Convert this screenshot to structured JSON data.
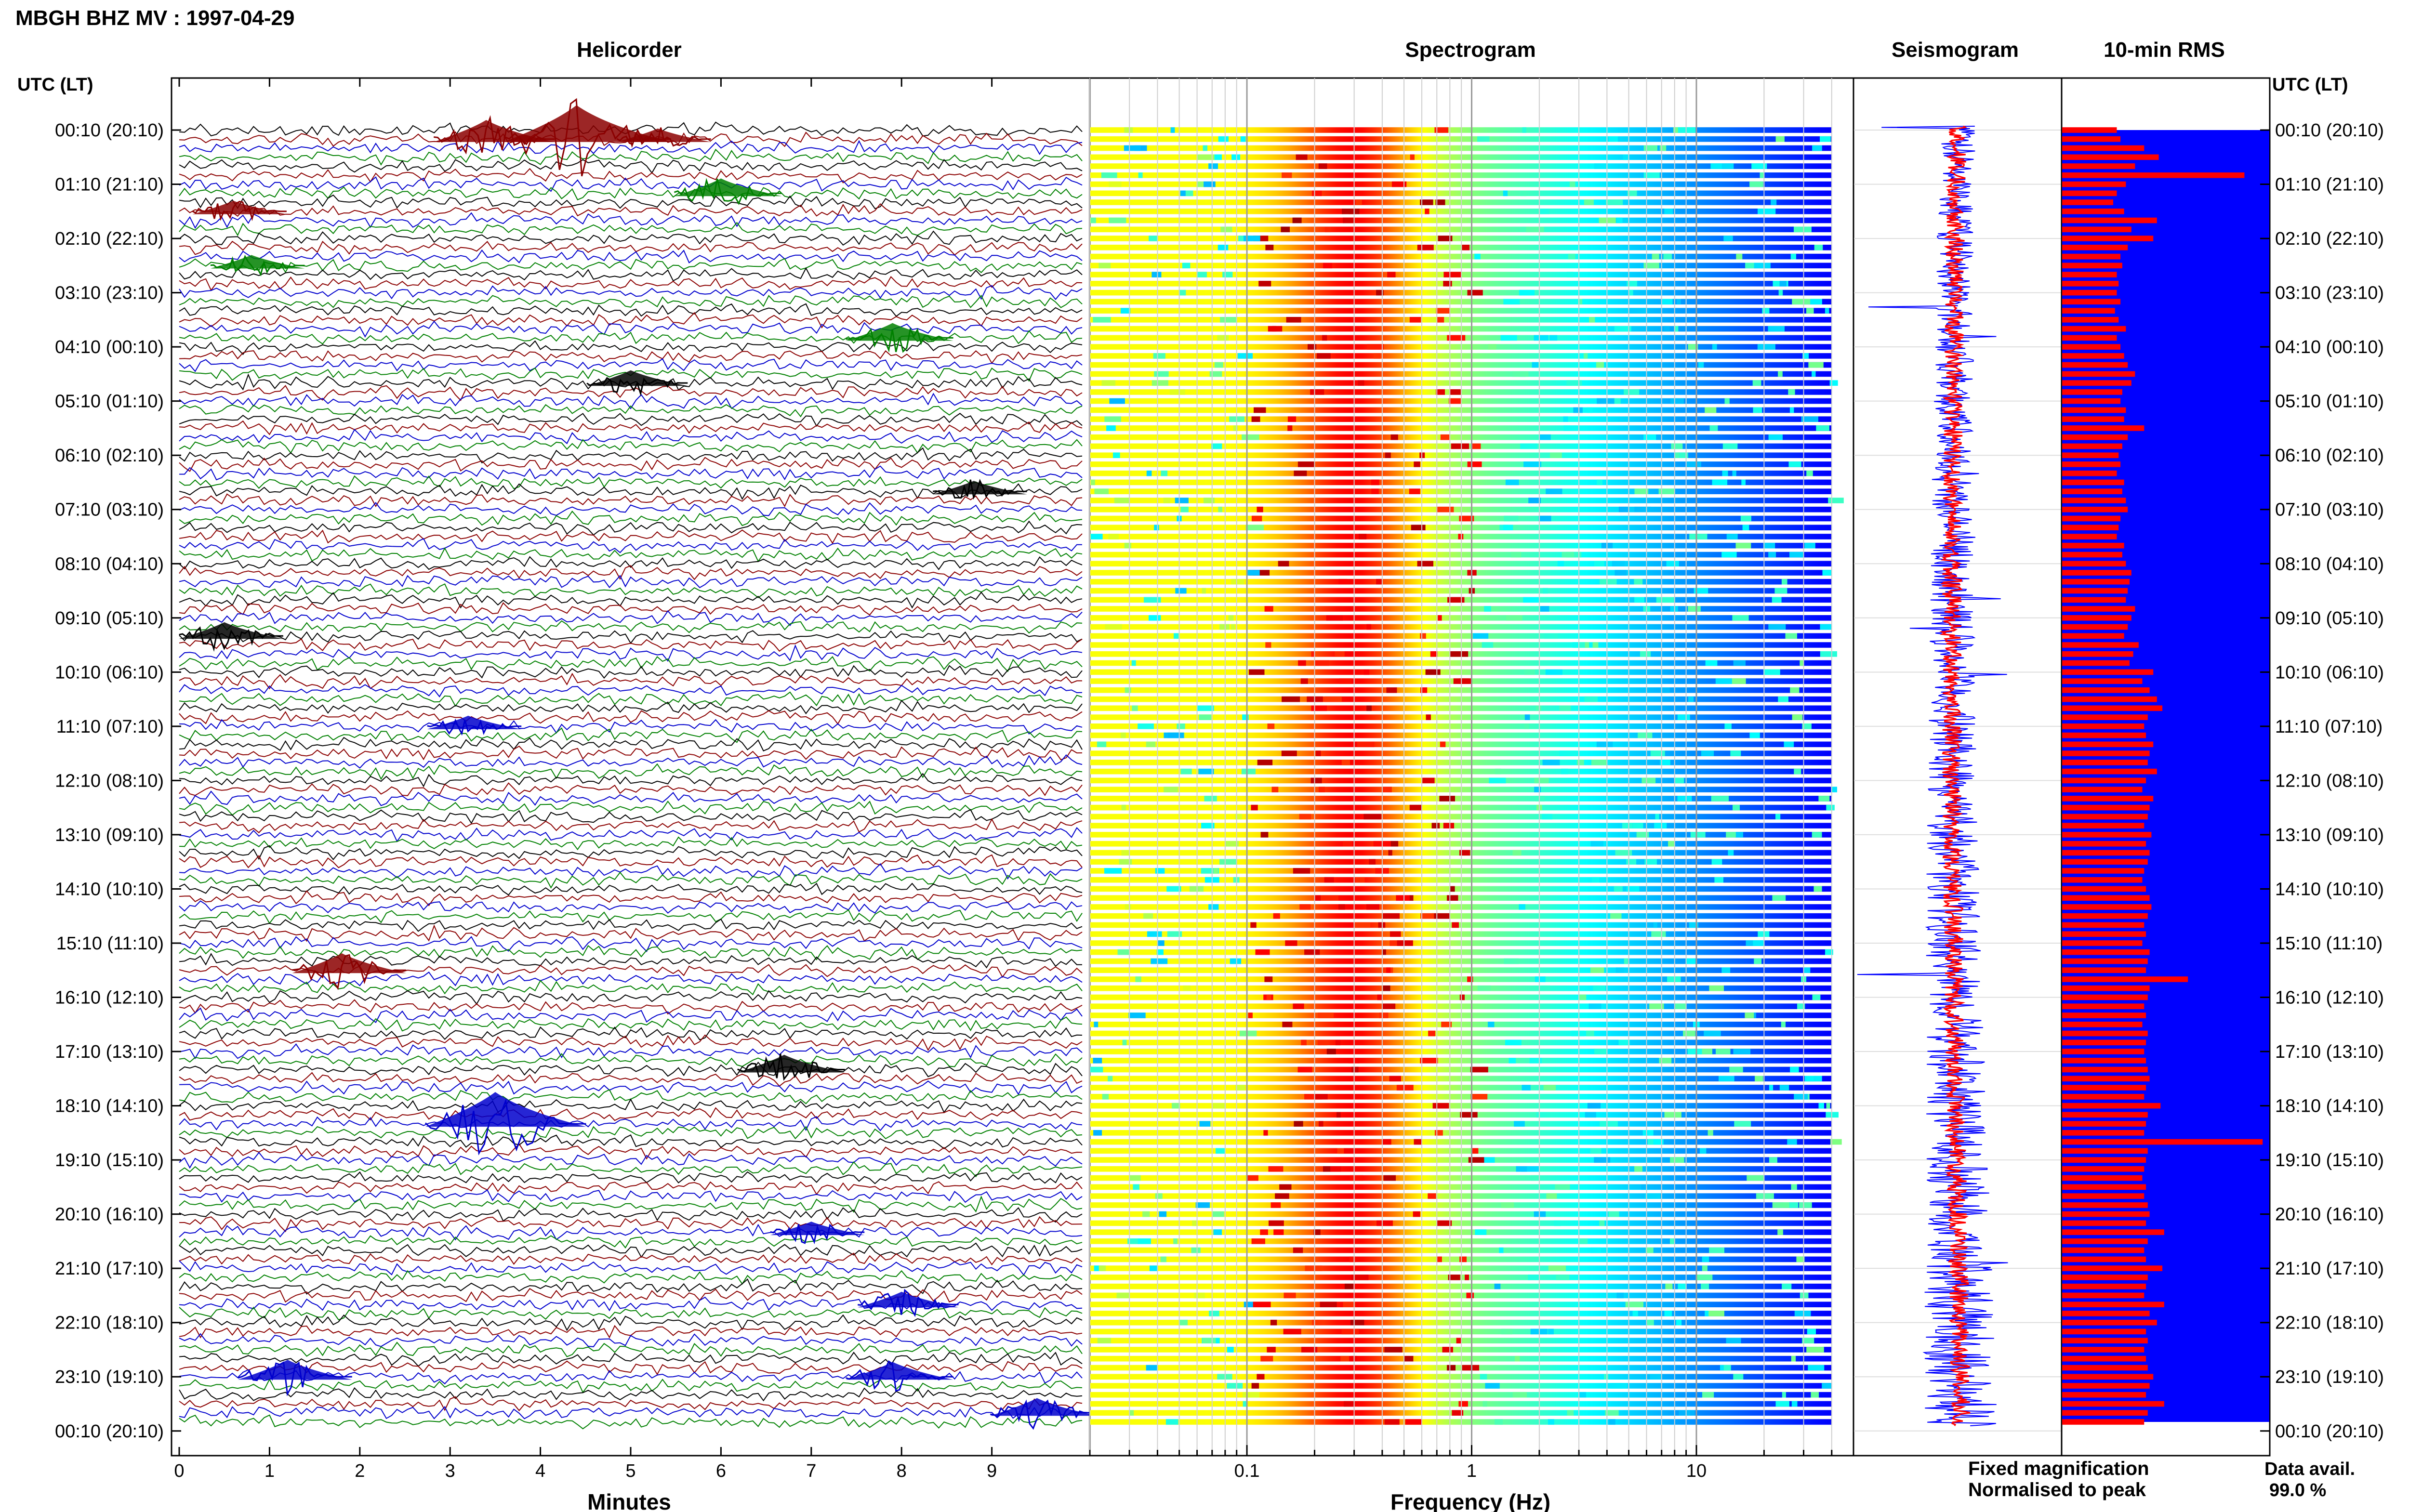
{
  "title": "MBGH BHZ MV : 1997-04-29",
  "panels": {
    "helicorder": "Helicorder",
    "spectrogram": "Spectrogram",
    "seismogram": "Seismogram",
    "rms": "10-min RMS"
  },
  "time_axis_header_left": "UTC (LT)",
  "time_axis_header_right": "UTC (LT)",
  "legend": {
    "fixed": "Fixed magnification",
    "normalised": "Normalised to peak",
    "fixed_color": "#0000ff",
    "normalised_color": "#ff0000"
  },
  "data_avail": {
    "label": "Data avail.",
    "value": "99.0 %"
  },
  "colors": {
    "trace_cycle": [
      "#000000",
      "#8b0000",
      "#0000cd",
      "#008000"
    ],
    "rms_bar": "#ff0000",
    "rms_background": "#0000ff",
    "seismo_fixed": "#0000ff",
    "seismo_norm": "#ff0000"
  },
  "chart_data": [
    {
      "type": "line",
      "name": "helicorder",
      "title": "Helicorder",
      "xlabel": "Minutes",
      "xlim": [
        0,
        10
      ],
      "x_ticks": [
        "0",
        "1",
        "2",
        "3",
        "4",
        "5",
        "6",
        "7",
        "8",
        "9"
      ],
      "rows_per_hour": 6,
      "row_count": 144,
      "y_tick_labels": [
        "00:10 (20:10)",
        "01:10 (21:10)",
        "02:10 (22:10)",
        "03:10 (23:10)",
        "04:10 (00:10)",
        "05:10 (01:10)",
        "06:10 (02:10)",
        "07:10 (03:10)",
        "08:10 (04:10)",
        "09:10 (05:10)",
        "10:10 (06:10)",
        "11:10 (07:10)",
        "12:10 (08:10)",
        "13:10 (09:10)",
        "14:10 (10:10)",
        "15:10 (11:10)",
        "16:10 (12:10)",
        "17:10 (13:10)",
        "18:10 (14:10)",
        "19:10 (15:10)",
        "20:10 (16:10)",
        "21:10 (17:10)",
        "22:10 (18:10)",
        "23:10 (19:10)",
        "00:10 (20:10)"
      ],
      "events": [
        {
          "row": 1,
          "minute": 4.4,
          "amp": 3.2
        },
        {
          "row": 1,
          "minute": 3.4,
          "amp": 1.8
        },
        {
          "row": 1,
          "minute": 5.3,
          "amp": 1.0
        },
        {
          "row": 7,
          "minute": 6.0,
          "amp": 1.4
        },
        {
          "row": 9,
          "minute": 0.6,
          "amp": 1.0
        },
        {
          "row": 15,
          "minute": 0.8,
          "amp": 1.0
        },
        {
          "row": 23,
          "minute": 7.9,
          "amp": 1.4
        },
        {
          "row": 28,
          "minute": 5.0,
          "amp": 1.2
        },
        {
          "row": 40,
          "minute": 8.8,
          "amp": 1.0
        },
        {
          "row": 56,
          "minute": 0.5,
          "amp": 1.3
        },
        {
          "row": 66,
          "minute": 3.2,
          "amp": 1.0
        },
        {
          "row": 93,
          "minute": 1.8,
          "amp": 1.6
        },
        {
          "row": 104,
          "minute": 6.7,
          "amp": 1.4
        },
        {
          "row": 110,
          "minute": 3.5,
          "amp": 3.0
        },
        {
          "row": 122,
          "minute": 7.0,
          "amp": 1.0
        },
        {
          "row": 130,
          "minute": 8.0,
          "amp": 1.2
        },
        {
          "row": 138,
          "minute": 1.2,
          "amp": 1.6
        },
        {
          "row": 138,
          "minute": 7.9,
          "amp": 1.4
        },
        {
          "row": 142,
          "minute": 9.5,
          "amp": 1.4
        }
      ]
    },
    {
      "type": "heatmap",
      "name": "spectrogram",
      "title": "Spectrogram",
      "xlabel": "Frequency (Hz)",
      "x_scale": "log",
      "xlim": [
        0.02,
        50
      ],
      "x_tick_values": [
        0.1,
        1,
        10
      ],
      "x_ticks": [
        "0.1",
        "1",
        "10"
      ],
      "peak_band_hz": [
        0.2,
        0.45
      ],
      "colormap": "jet",
      "rows": 144
    },
    {
      "type": "line",
      "name": "seismogram",
      "title": "Seismogram",
      "series": [
        {
          "name": "Fixed magnification",
          "color": "#0000ff"
        },
        {
          "name": "Normalised to peak",
          "color": "#ff0000"
        }
      ]
    },
    {
      "type": "bar",
      "name": "rms",
      "title": "10-min RMS",
      "orientation": "horizontal",
      "categories_count": 144,
      "values": [
        0.3,
        0.32,
        0.45,
        0.53,
        0.4,
        1.0,
        0.35,
        0.3,
        0.28,
        0.34,
        0.52,
        0.38,
        0.5,
        0.36,
        0.32,
        0.33,
        0.3,
        0.31,
        0.3,
        0.32,
        0.29,
        0.31,
        0.35,
        0.3,
        0.32,
        0.34,
        0.36,
        0.4,
        0.38,
        0.33,
        0.32,
        0.35,
        0.34,
        0.45,
        0.36,
        0.33,
        0.31,
        0.32,
        0.3,
        0.34,
        0.33,
        0.35,
        0.36,
        0.32,
        0.31,
        0.3,
        0.34,
        0.33,
        0.35,
        0.38,
        0.37,
        0.36,
        0.35,
        0.4,
        0.38,
        0.36,
        0.34,
        0.42,
        0.39,
        0.37,
        0.5,
        0.44,
        0.48,
        0.52,
        0.55,
        0.47,
        0.45,
        0.46,
        0.5,
        0.48,
        0.47,
        0.52,
        0.46,
        0.44,
        0.5,
        0.48,
        0.47,
        0.45,
        0.49,
        0.46,
        0.48,
        0.47,
        0.45,
        0.44,
        0.46,
        0.48,
        0.49,
        0.47,
        0.45,
        0.46,
        0.44,
        0.48,
        0.47,
        0.46,
        0.69,
        0.48,
        0.47,
        0.45,
        0.46,
        0.44,
        0.47,
        0.46,
        0.45,
        0.46,
        0.47,
        0.48,
        0.46,
        0.45,
        0.54,
        0.47,
        0.46,
        0.45,
        1.1,
        0.47,
        0.46,
        0.45,
        0.44,
        0.46,
        0.45,
        0.47,
        0.48,
        0.46,
        0.56,
        0.47,
        0.45,
        0.46,
        0.55,
        0.47,
        0.46,
        0.45,
        0.56,
        0.48,
        0.52,
        0.46,
        0.47,
        0.45,
        0.46,
        0.47,
        0.5,
        0.48,
        0.46,
        0.56,
        0.47,
        0.45
      ]
    }
  ]
}
